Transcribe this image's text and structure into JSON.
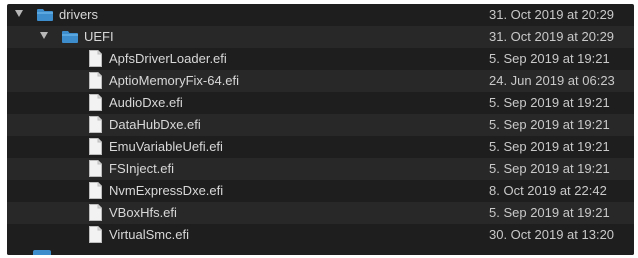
{
  "accent_color": "#3d8ccc",
  "rows": [
    {
      "name": "drivers",
      "date": "31. Oct 2019 at 20:29",
      "kind": "folder",
      "icon": "folder-icon",
      "expanded": true,
      "level": 0
    },
    {
      "name": "UEFI",
      "date": "31. Oct 2019 at 20:29",
      "kind": "folder",
      "icon": "folder-icon",
      "expanded": true,
      "level": 1
    },
    {
      "name": "ApfsDriverLoader.efi",
      "date": "5. Sep 2019 at 19:21",
      "kind": "file",
      "icon": "document-icon",
      "level": 2
    },
    {
      "name": "AptioMemoryFix-64.efi",
      "date": "24. Jun 2019 at 06:23",
      "kind": "file",
      "icon": "document-icon",
      "level": 2
    },
    {
      "name": "AudioDxe.efi",
      "date": "5. Sep 2019 at 19:21",
      "kind": "file",
      "icon": "document-icon",
      "level": 2
    },
    {
      "name": "DataHubDxe.efi",
      "date": "5. Sep 2019 at 19:21",
      "kind": "file",
      "icon": "document-icon",
      "level": 2
    },
    {
      "name": "EmuVariableUefi.efi",
      "date": "5. Sep 2019 at 19:21",
      "kind": "file",
      "icon": "document-icon",
      "level": 2
    },
    {
      "name": "FSInject.efi",
      "date": "5. Sep 2019 at 19:21",
      "kind": "file",
      "icon": "document-icon",
      "level": 2
    },
    {
      "name": "NvmExpressDxe.efi",
      "date": "8. Oct 2019 at 22:42",
      "kind": "file",
      "icon": "document-icon",
      "level": 2
    },
    {
      "name": "VBoxHfs.efi",
      "date": "5. Sep 2019 at 19:21",
      "kind": "file",
      "icon": "document-icon",
      "level": 2
    },
    {
      "name": "VirtualSmc.efi",
      "date": "30. Oct 2019 at 13:20",
      "kind": "file",
      "icon": "document-icon",
      "level": 2
    }
  ]
}
